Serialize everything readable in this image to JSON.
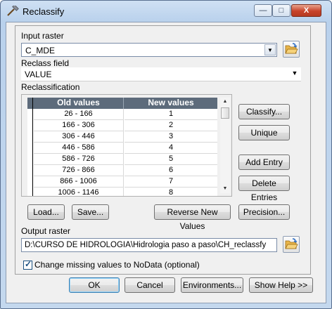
{
  "window": {
    "title": "Reclassify",
    "minimize": "—",
    "maximize": "□",
    "close": "X"
  },
  "input_raster": {
    "label": "Input raster",
    "value": "C_MDE"
  },
  "reclass_field": {
    "label": "Reclass field",
    "value": "VALUE"
  },
  "reclassification": {
    "label": "Reclassification",
    "columns": [
      "Old values",
      "New values"
    ],
    "rows": [
      {
        "old": "26 - 166",
        "new": "1"
      },
      {
        "old": "166 - 306",
        "new": "2"
      },
      {
        "old": "306 - 446",
        "new": "3"
      },
      {
        "old": "446 - 586",
        "new": "4"
      },
      {
        "old": "586 - 726",
        "new": "5"
      },
      {
        "old": "726 - 866",
        "new": "6"
      },
      {
        "old": "866 - 1006",
        "new": "7"
      },
      {
        "old": "1006 - 1146",
        "new": "8"
      }
    ]
  },
  "side_buttons": {
    "classify": "Classify...",
    "unique": "Unique",
    "add_entry": "Add Entry",
    "delete_entries": "Delete Entries"
  },
  "bottom_buttons": {
    "load": "Load...",
    "save": "Save...",
    "reverse": "Reverse New Values",
    "precision": "Precision..."
  },
  "output_raster": {
    "label": "Output raster",
    "value": "D:\\CURSO DE HIDROLOGIA\\Hidrologia paso a paso\\CH_reclassfy"
  },
  "missing": {
    "label": "Change missing values to NoData (optional)",
    "checked": true
  },
  "dialog_buttons": {
    "ok": "OK",
    "cancel": "Cancel",
    "environments": "Environments...",
    "show_help": "Show Help >>"
  },
  "icons": {
    "title": "hammer-icon",
    "open_input": "folder-open-icon",
    "open_output": "folder-open-icon"
  }
}
